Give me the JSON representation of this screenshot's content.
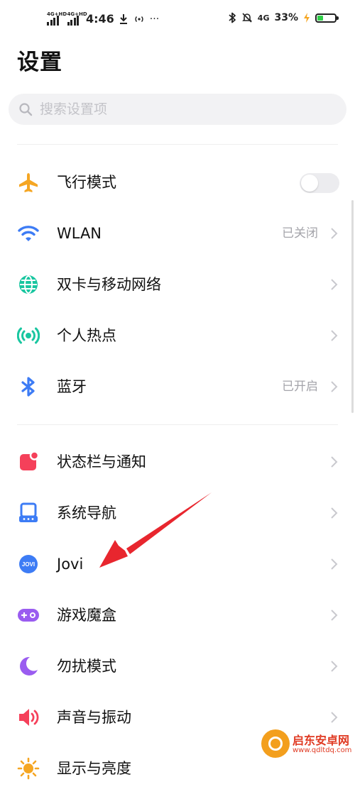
{
  "status_bar": {
    "sim1": "4G+HD",
    "sim2": "4G+HD",
    "time": "4:46",
    "more": "···",
    "network": "4G",
    "battery_pct": "33%",
    "battery_level": 0.33
  },
  "page_title": "设置",
  "search": {
    "placeholder": "搜索设置项"
  },
  "sections": [
    {
      "items": [
        {
          "label": "飞行模式",
          "control": "toggle",
          "on": false,
          "icon": "airplane-icon",
          "color": "#f5a623"
        },
        {
          "label": "WLAN",
          "value": "已关闭",
          "icon": "wifi-icon",
          "color": "#3d7cf5"
        },
        {
          "label": "双卡与移动网络",
          "icon": "globe-icon",
          "color": "#19c6a0"
        },
        {
          "label": "个人热点",
          "icon": "hotspot-icon",
          "color": "#19c6a0"
        },
        {
          "label": "蓝牙",
          "value": "已开启",
          "icon": "bluetooth-icon",
          "color": "#3d7cf5"
        }
      ]
    },
    {
      "items": [
        {
          "label": "状态栏与通知",
          "icon": "notification-icon",
          "color": "#f5405a"
        },
        {
          "label": "系统导航",
          "icon": "navigation-icon",
          "color": "#3d7cf5"
        },
        {
          "label": "Jovi",
          "icon": "jovi-icon",
          "icon_text": "JOVI",
          "color": "#3d7cf5"
        },
        {
          "label": "游戏魔盒",
          "icon": "gamepad-icon",
          "color": "#9a5cf0"
        },
        {
          "label": "勿扰模式",
          "icon": "moon-icon",
          "color": "#9a5cf0"
        },
        {
          "label": "声音与振动",
          "icon": "speaker-icon",
          "color": "#f5405a"
        },
        {
          "label": "显示与亮度",
          "icon": "sun-icon",
          "color": "#f5a623"
        }
      ]
    }
  ],
  "watermark": {
    "name": "启东安卓网",
    "url": "www.qdltdq.com"
  },
  "annotation_color": "#e8262e"
}
